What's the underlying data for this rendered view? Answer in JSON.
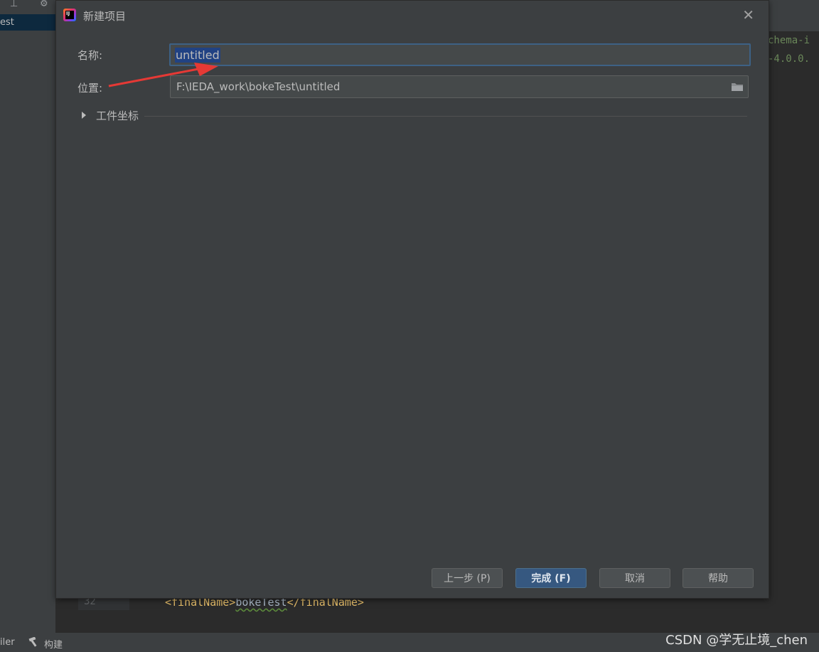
{
  "ide": {
    "left_selected_label": "est",
    "line_number": "32",
    "code": {
      "open_tag": "<finalName>",
      "text": "bokeTest",
      "close_tag": "</finalName>"
    },
    "right_code_lines": [
      "chema-i",
      "-4.0.0."
    ],
    "bottom_left_label": "iler",
    "bottom_build_label": "构建",
    "build_icon": "hammer-icon"
  },
  "dialog": {
    "title": "新建项目",
    "logo_text": "IJ",
    "name_label": "名称:",
    "name_value": "untitled",
    "location_label": "位置:",
    "location_value": "F:\\IEDA_work\\bokeTest\\untitled",
    "coords_label": "工件坐标",
    "buttons": {
      "prev": "上一步 (P)",
      "finish": "完成 (F)",
      "cancel": "取消",
      "help": "帮助"
    },
    "colors": {
      "dialog_bg": "#3c3f41",
      "focus_border": "#3d6185",
      "selection": "#214283",
      "primary_button": "#365880",
      "annotation_arrow": "#e53935"
    }
  },
  "watermark": "CSDN @学无止境_chen"
}
